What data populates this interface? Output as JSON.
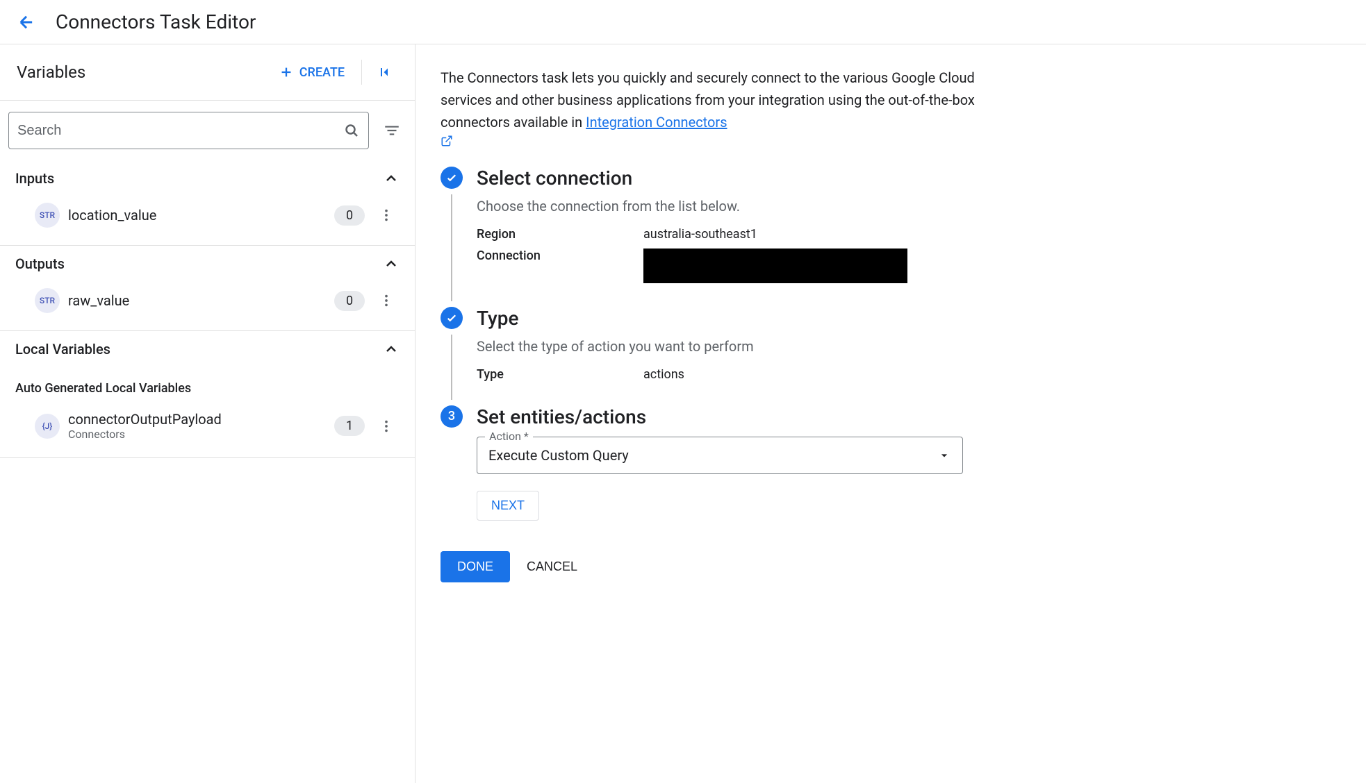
{
  "header": {
    "title": "Connectors Task Editor"
  },
  "sidebar": {
    "title": "Variables",
    "create_label": "CREATE",
    "search_placeholder": "Search",
    "sections": {
      "inputs": {
        "title": "Inputs",
        "items": [
          {
            "type": "STR",
            "name": "location_value",
            "count": "0"
          }
        ]
      },
      "outputs": {
        "title": "Outputs",
        "items": [
          {
            "type": "STR",
            "name": "raw_value",
            "count": "0"
          }
        ]
      },
      "local": {
        "title": "Local Variables",
        "auto_title": "Auto Generated Local Variables",
        "items": [
          {
            "type": "{J}",
            "name": "connectorOutputPayload",
            "sub": "Connectors",
            "count": "1"
          }
        ]
      }
    }
  },
  "main": {
    "intro_text": "The Connectors task lets you quickly and securely connect to the various Google Cloud services and other business applications from your integration using the out-of-the-box connectors available in ",
    "intro_link": "Integration Connectors",
    "steps": {
      "select_connection": {
        "title": "Select connection",
        "desc": "Choose the connection from the list below.",
        "region_label": "Region",
        "region_value": "australia-southeast1",
        "connection_label": "Connection"
      },
      "type": {
        "title": "Type",
        "desc": "Select the type of action you want to perform",
        "type_label": "Type",
        "type_value": "actions"
      },
      "entities": {
        "number": "3",
        "title": "Set entities/actions",
        "action_label": "Action *",
        "action_value": "Execute Custom Query",
        "next_label": "NEXT"
      }
    },
    "done_label": "DONE",
    "cancel_label": "CANCEL"
  }
}
